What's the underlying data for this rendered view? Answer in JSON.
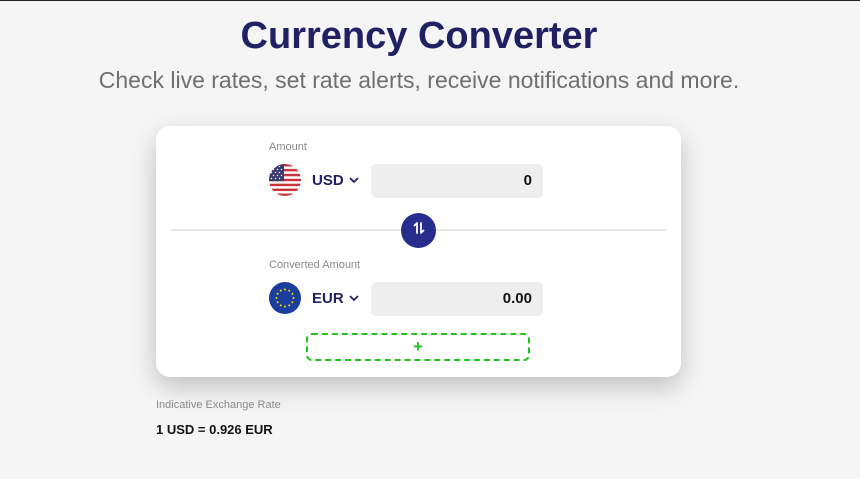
{
  "header": {
    "title": "Currency Converter",
    "subtitle": "Check live rates, set rate alerts, receive notifications and more."
  },
  "converter": {
    "from": {
      "label": "Amount",
      "currency": "USD",
      "flag_icon": "us-flag-icon",
      "value": "0"
    },
    "to": {
      "label": "Converted Amount",
      "currency": "EUR",
      "flag_icon": "eu-flag-icon",
      "value": "0.00"
    },
    "swap_icon": "swap-arrows-icon",
    "add_label": "+"
  },
  "rate": {
    "label": "Indicative Exchange Rate",
    "value": "1 USD = 0.926 EUR"
  },
  "colors": {
    "brand": "#1f2163",
    "swap_button": "#262d8c",
    "add_border": "#22c21f",
    "background": "#f5f5f6"
  }
}
